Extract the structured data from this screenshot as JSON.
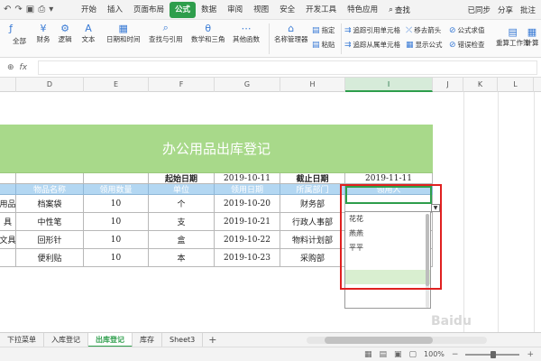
{
  "ribbon_tabs": {
    "items": [
      "开始",
      "插入",
      "页面布局",
      "公式",
      "数据",
      "审阅",
      "视图",
      "安全",
      "开发工具",
      "特色应用"
    ],
    "active": "公式",
    "search_label": "查找",
    "right": [
      "已同步",
      "分享",
      "批注"
    ]
  },
  "ribbon": {
    "insert_func": "fx",
    "groups": [
      "全部",
      "财务",
      "逻辑",
      "文本",
      "日期和时间",
      "查找与引用",
      "数学和三角",
      "其他函数",
      "名称管理器"
    ],
    "small": [
      "指定",
      "追踪引用单元格",
      "移去箭头",
      "公式求值",
      "粘贴",
      "追踪从属单元格",
      "显示公式",
      "错误检查",
      "重算工作簿",
      "计算"
    ]
  },
  "formula_bar": {
    "fx_label": "fx",
    "value": ""
  },
  "columns": [
    "D",
    "E",
    "F",
    "G",
    "H",
    "I",
    "J",
    "K",
    "L"
  ],
  "sheet": {
    "title": "办公用品出库登记",
    "date_row": {
      "start_label": "起始日期",
      "start_value": "2019-10-11",
      "end_label": "截止日期",
      "end_value": "2019-11-11"
    },
    "headers": [
      "物品名称",
      "领用数量",
      "单位",
      "领用日期",
      "所属部门",
      "领用人"
    ],
    "rows": [
      {
        "cat": "用品",
        "name": "档案袋",
        "qty": "10",
        "unit": "个",
        "date": "2019-10-20",
        "dept": "财务部"
      },
      {
        "cat": "具",
        "name": "中性笔",
        "qty": "10",
        "unit": "支",
        "date": "2019-10-21",
        "dept": "行政人事部"
      },
      {
        "cat": "文具",
        "name": "回形针",
        "qty": "10",
        "unit": "盒",
        "date": "2019-10-22",
        "dept": "物料计划部"
      },
      {
        "cat": "",
        "name": "便利贴",
        "qty": "10",
        "unit": "本",
        "date": "2019-10-23",
        "dept": "采购部"
      }
    ]
  },
  "dropdown": {
    "options": [
      "花花",
      "燕燕",
      "平平"
    ]
  },
  "sheet_tabs": {
    "items": [
      "下拉菜单",
      "入库登记",
      "出库登记",
      "库存",
      "Sheet3"
    ],
    "active": "出库登记",
    "add": "+"
  },
  "status": {
    "zoom": "100%"
  },
  "watermark": "Baidu"
}
